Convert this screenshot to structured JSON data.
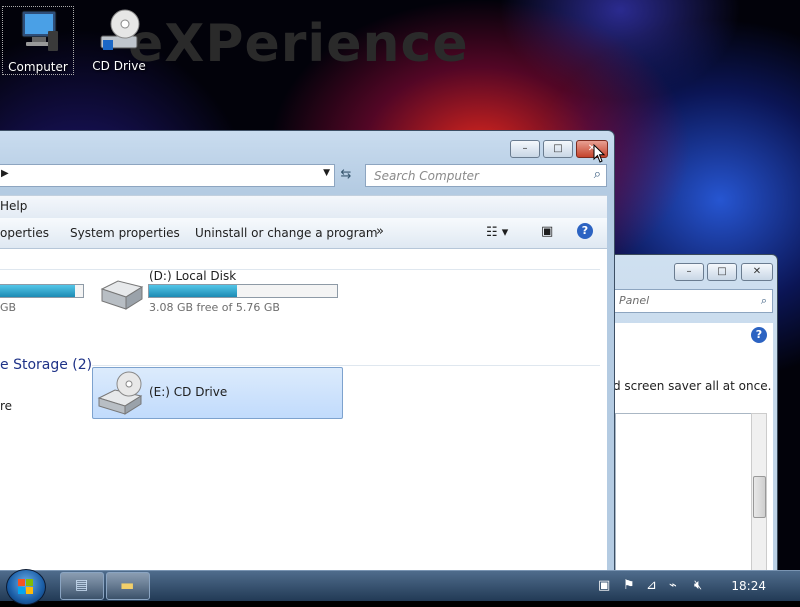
{
  "desktop": {
    "watermark": "eXPerience",
    "icons": [
      {
        "label": "Computer",
        "icon": "computer-icon"
      },
      {
        "label": "CD Drive",
        "icon": "cd-drive-icon"
      }
    ]
  },
  "window2": {
    "search_placeholder": "Panel",
    "text": "d screen saver all at once.",
    "help_icon": "help-icon"
  },
  "explorer": {
    "controls": {
      "minimize": "–",
      "maximize": "□",
      "close": "✕"
    },
    "address_arrow": "▶",
    "search_placeholder": "Search Computer",
    "menu": {
      "help": "Help"
    },
    "toolbar": {
      "properties": "operties",
      "system_properties": "System properties",
      "uninstall": "Uninstall or change a program",
      "more": "»"
    },
    "drives": {
      "c_fragment": "GB",
      "d_name": "(D:) Local Disk",
      "d_free": "3.08 GB free of 5.76 GB",
      "d_used_fraction": 0.47,
      "c_used_fraction": 0.9
    },
    "removable_group": "e Storage (2)",
    "removable_left_fragment": "re",
    "cd_drive": "(E:) CD Drive"
  },
  "taskbar": {
    "clock": "18:24"
  },
  "colors": {
    "accent_blue": "#1e3287",
    "drive_bar": "#1d8bb4",
    "close_red": "#c5432c"
  }
}
